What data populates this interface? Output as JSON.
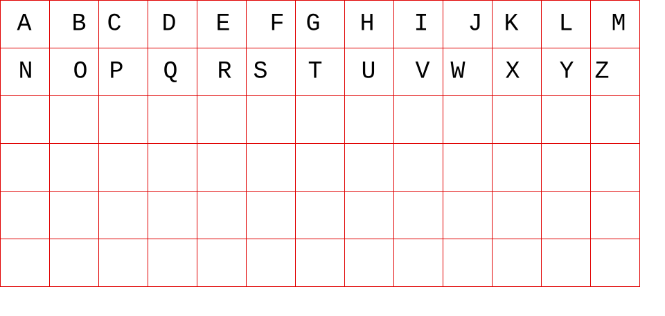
{
  "grid": {
    "rows": [
      [
        "A",
        "B",
        "C",
        "D",
        "E",
        "F",
        "G",
        "H",
        "I",
        "J",
        "K",
        "L",
        "M"
      ],
      [
        "N",
        "O",
        "P",
        "Q",
        "R",
        "S",
        "T",
        "U",
        "V",
        "W",
        "X",
        "Y",
        "Z"
      ],
      [
        "",
        "",
        "",
        "",
        "",
        "",
        "",
        "",
        "",
        "",
        "",
        "",
        ""
      ],
      [
        "",
        "",
        "",
        "",
        "",
        "",
        "",
        "",
        "",
        "",
        "",
        "",
        ""
      ],
      [
        "",
        "",
        "",
        "",
        "",
        "",
        "",
        "",
        "",
        "",
        "",
        "",
        ""
      ],
      [
        "",
        "",
        "",
        "",
        "",
        "",
        "",
        "",
        "",
        "",
        "",
        "",
        ""
      ]
    ]
  },
  "colors": {
    "grid_line": "#e00000",
    "text": "#000000",
    "background": "#ffffff"
  }
}
